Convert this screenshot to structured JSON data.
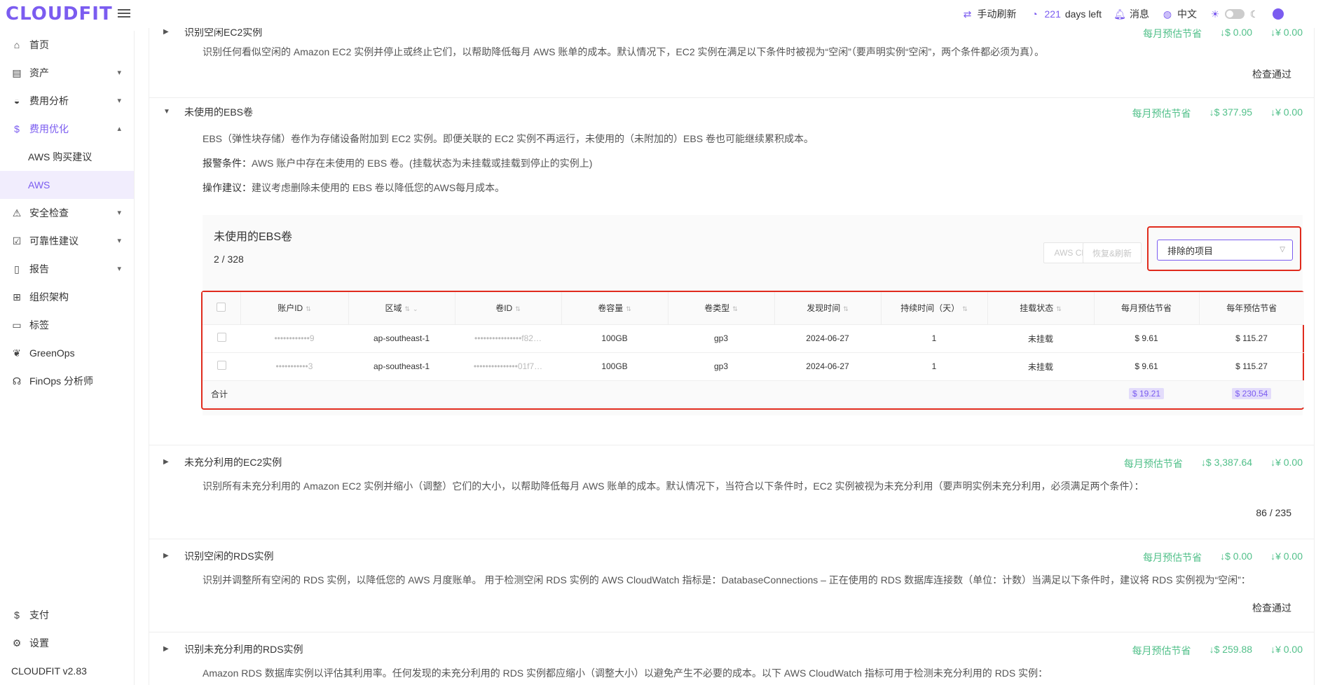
{
  "app": {
    "logo": "CLOUDFIT"
  },
  "topbar": {
    "refresh": "手动刷新",
    "days_num": "221",
    "days_suffix": "days left",
    "messages": "消息",
    "language": "中文"
  },
  "sidebar": {
    "items": [
      {
        "label": "首页",
        "icon": "home-icon"
      },
      {
        "label": "资产",
        "icon": "asset-icon",
        "chevron": "⌄"
      },
      {
        "label": "费用分析",
        "icon": "gauge-icon",
        "chevron": "⌄"
      },
      {
        "label": "费用优化",
        "icon": "dollar-icon",
        "chevron": "⌃"
      },
      {
        "label": "安全检查",
        "icon": "alarm-icon",
        "chevron": "⌄"
      },
      {
        "label": "可靠性建议",
        "icon": "report-check-icon",
        "chevron": "⌄"
      },
      {
        "label": "报告",
        "icon": "document-icon",
        "chevron": "⌄"
      },
      {
        "label": "组织架构",
        "icon": "org-icon"
      },
      {
        "label": "标签",
        "icon": "tag-icon"
      },
      {
        "label": "GreenOps",
        "icon": "leaf-icon"
      },
      {
        "label": "FinOps 分析师",
        "icon": "analyst-icon"
      }
    ],
    "subitems": [
      "AWS 购买建议",
      "AWS"
    ],
    "bottom": [
      {
        "label": "支付",
        "icon": "payment-icon"
      },
      {
        "label": "设置",
        "icon": "gear-icon"
      }
    ],
    "version": "CLOUDFIT v2.83"
  },
  "sections": {
    "idle_ec2": {
      "title": "识别空闲EC2实例",
      "savings_label": "每月预估节省",
      "usd": "↓$ 0.00",
      "cny": "↓¥ 0.00",
      "desc": "识别任何看似空闲的 Amazon EC2 实例并停止或终止它们，以帮助降低每月 AWS 账单的成本。默认情况下，EC2 实例在满足以下条件时被视为“空闲”（要声明实例“空闲”，两个条件都必须为真）。",
      "status": "检查通过"
    },
    "ebs": {
      "title": "未使用的EBS卷",
      "savings_label": "每月预估节省",
      "usd": "↓$ 377.95",
      "cny": "↓¥ 0.00",
      "desc": "EBS（弹性块存储）卷作为存储设备附加到 EC2 实例。即便关联的 EC2 实例不再运行，未使用的（未附加的）EBS 卷也可能继续累积成本。",
      "alert_label": "报警条件：",
      "alert_text": "AWS 账户中存在未使用的 EBS 卷。(挂载状态为未挂载或挂载到停止的实例上)",
      "action_label": "操作建议：",
      "action_text": "建议考虑删除未使用的 EBS 卷以降低您的AWS每月成本。",
      "card": {
        "title": "未使用的EBS卷",
        "count": "2 / 328",
        "btn_cli": "AWS CLI",
        "btn_refresh": "恢复&刷新",
        "select": "排除的项目"
      },
      "table": {
        "headers": [
          "账户ID",
          "区域",
          "卷ID",
          "卷容量",
          "卷类型",
          "发现时间",
          "持续时间（天）",
          "挂载状态",
          "每月预估节省",
          "每年预估节省"
        ],
        "rows": [
          [
            "••••••••••••9",
            "ap-southeast-1",
            "••••••••••••••••f82…",
            "100GB",
            "gp3",
            "2024-06-27",
            "1",
            "未挂载",
            "$ 9.61",
            "$ 115.27"
          ],
          [
            "•••••••••••3",
            "ap-southeast-1",
            "•••••••••••••••01f7…",
            "100GB",
            "gp3",
            "2024-06-27",
            "1",
            "未挂载",
            "$ 9.61",
            "$ 115.27"
          ]
        ],
        "total_label": "合计",
        "total_month": "$ 19.21",
        "total_year": "$ 230.54"
      }
    },
    "under_ec2": {
      "title": "未充分利用的EC2实例",
      "savings_label": "每月预估节省",
      "usd": "↓$ 3,387.64",
      "cny": "↓¥ 0.00",
      "desc": "识别所有未充分利用的 Amazon EC2 实例并缩小（调整）它们的大小，以帮助降低每月 AWS 账单的成本。默认情况下，当符合以下条件时，EC2 实例被视为未充分利用（要声明实例未充分利用，必须满足两个条件）：",
      "count": "86 / 235"
    },
    "idle_rds": {
      "title": "识别空闲的RDS实例",
      "savings_label": "每月预估节省",
      "usd": "↓$ 0.00",
      "cny": "↓¥ 0.00",
      "desc": "识别并调整所有空闲的 RDS 实例，以降低您的 AWS 月度账单。 用于检测空闲 RDS 实例的 AWS CloudWatch 指标是：DatabaseConnections – 正在使用的 RDS 数据库连接数（单位：计数）当满足以下条件时，建议将 RDS 实例视为“空闲”：",
      "status": "检查通过"
    },
    "under_rds": {
      "title": "识别未充分利用的RDS实例",
      "savings_label": "每月预估节省",
      "usd": "↓$ 259.88",
      "cny": "↓¥ 0.00",
      "desc": "Amazon RDS 数据库实例以评估其利用率。任何发现的未充分利用的 RDS 实例都应缩小（调整大小）以避免产生不必要的成本。以下 AWS CloudWatch 指标可用于检测未充分利用的 RDS 实例："
    }
  }
}
